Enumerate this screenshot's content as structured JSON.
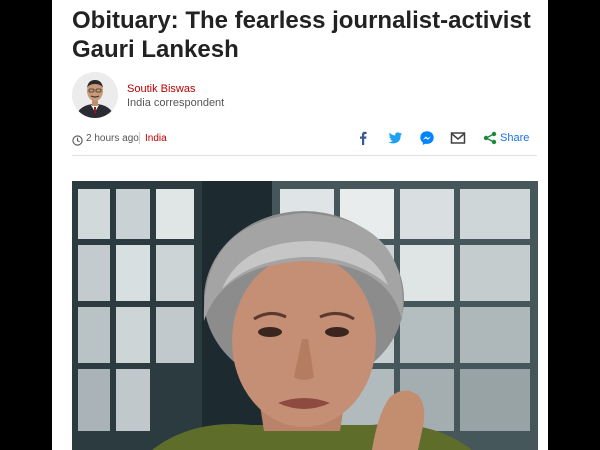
{
  "article": {
    "headline": "Obituary: The fearless journalist-activist Gauri Lankesh"
  },
  "author": {
    "name": "Soutik Biswas",
    "role": "India correspondent"
  },
  "meta": {
    "timestamp": "2 hours ago",
    "section": "India"
  },
  "share": {
    "label": "Share",
    "buttons": [
      "facebook-icon",
      "twitter-icon",
      "messenger-icon",
      "email-icon",
      "share-icon"
    ]
  },
  "colors": {
    "accent": "#b80000",
    "facebook": "#3b5998",
    "twitter": "#1da1f2",
    "messenger": "#0084ff",
    "share": "#1a73e8"
  }
}
